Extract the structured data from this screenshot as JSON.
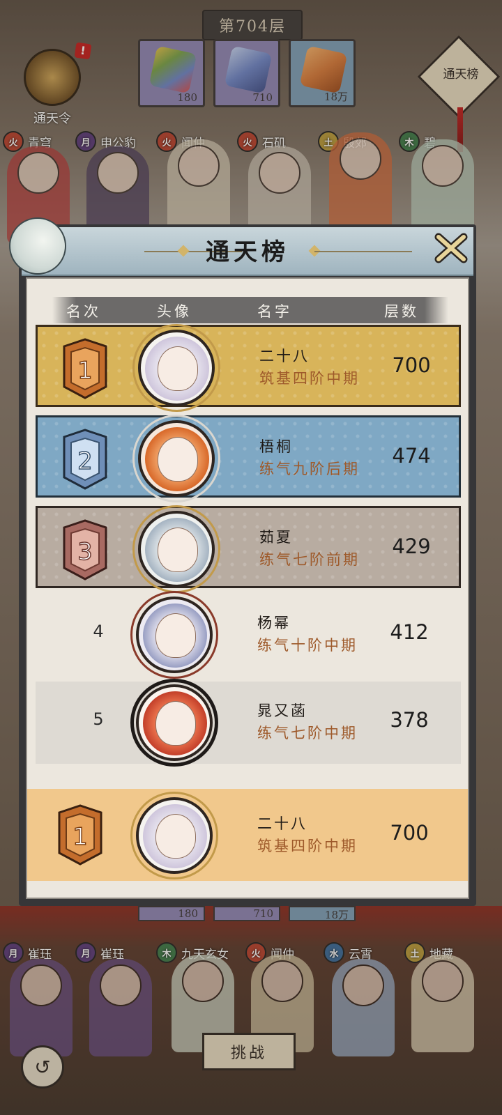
{
  "top": {
    "floor_label": "第704层",
    "token_label": "通天令",
    "alert_mark": "!",
    "side_badge": "通天榜",
    "relics": [
      {
        "count": "180",
        "color": "#7aa34a"
      },
      {
        "count": "710",
        "color": "#6f86c9"
      },
      {
        "count": "18万",
        "color": "#d87a3a"
      }
    ],
    "characters": [
      {
        "name": "青穹",
        "icon": "fire-element-icon"
      },
      {
        "name": "申公豹",
        "icon": "moon-element-icon"
      },
      {
        "name": "闻仲",
        "icon": "fire-element-icon"
      },
      {
        "name": "石矶",
        "icon": "fire-element-icon"
      },
      {
        "name": "殷郊",
        "icon": "earth-element-icon"
      },
      {
        "name": "碧",
        "icon": "wood-element-icon"
      }
    ]
  },
  "dialog": {
    "title": "通天榜",
    "columns": {
      "rank": "名次",
      "avatar": "头像",
      "name": "名字",
      "floors": "层数"
    },
    "rows": [
      {
        "rank": "1",
        "name": "二十八",
        "realm": "筑基四阶中期",
        "floors": "700",
        "style": "gold"
      },
      {
        "rank": "2",
        "name": "梧桐",
        "realm": "练气九阶后期",
        "floors": "474",
        "style": "blue"
      },
      {
        "rank": "3",
        "name": "茹夏",
        "realm": "练气七阶前期",
        "floors": "429",
        "style": "mauve"
      },
      {
        "rank": "4",
        "name": "杨幂",
        "realm": "练气十阶中期",
        "floors": "412",
        "style": "plain-a"
      },
      {
        "rank": "5",
        "name": "晁又菡",
        "realm": "练气七阶中期",
        "floors": "378",
        "style": "plain-b"
      }
    ],
    "self_row": {
      "rank": "1",
      "name": "二十八",
      "realm": "筑基四阶中期",
      "floors": "700"
    }
  },
  "bottom": {
    "relics": [
      {
        "count": "180"
      },
      {
        "count": "710"
      },
      {
        "count": "18万"
      }
    ],
    "team": [
      {
        "name": "崔珏",
        "icon": "moon-element-icon"
      },
      {
        "name": "崔珏",
        "icon": "moon-element-icon"
      },
      {
        "name": "九天玄女",
        "icon": "wood-element-icon"
      },
      {
        "name": "闻仲",
        "icon": "fire-element-icon"
      },
      {
        "name": "云霄",
        "icon": "water-element-icon"
      },
      {
        "name": "地藏",
        "icon": "earth-element-icon"
      }
    ],
    "challenge_label": "挑战",
    "back_symbol": "↺"
  },
  "colors": {
    "gold_row": "#d8b45a",
    "blue_row": "#7fa8c4",
    "mauve_row": "#b8aca1",
    "self_row": "#f1c88c",
    "realm_text": "#9e5a2b"
  }
}
